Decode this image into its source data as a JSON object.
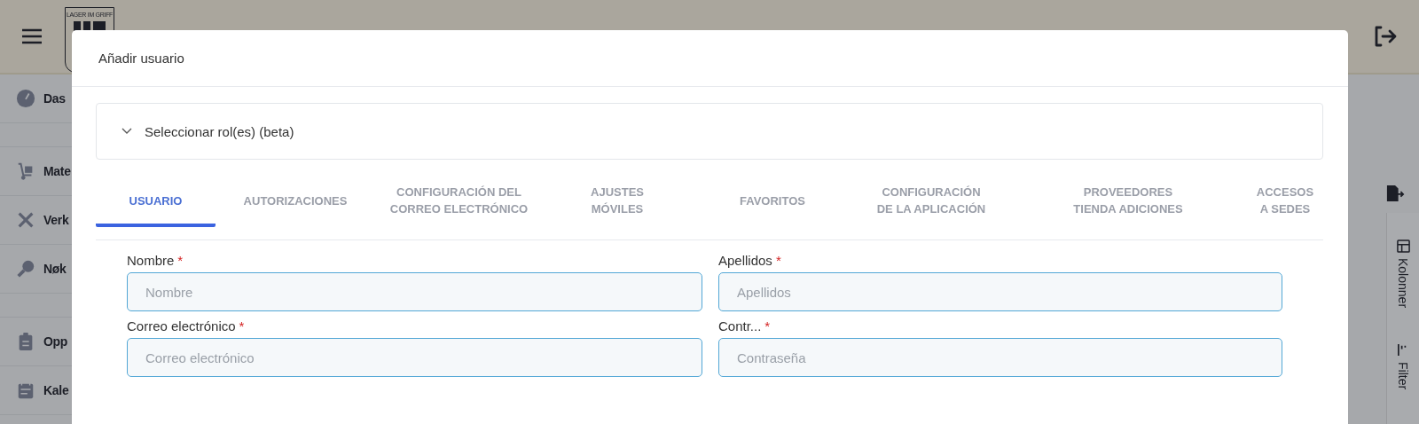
{
  "header": {
    "logo_text": "LAGER IM GRIFF"
  },
  "sidebar": {
    "items": [
      {
        "label": "Das",
        "kind": "gauge"
      },
      {
        "label": "Mate",
        "kind": "cart"
      },
      {
        "label": "Verk",
        "kind": "tools"
      },
      {
        "label": "Nøk",
        "kind": "key"
      },
      {
        "label": "Opp",
        "kind": "clipboard"
      },
      {
        "label": "Kale",
        "kind": "calendar"
      }
    ]
  },
  "side_panel": {
    "tabs": [
      {
        "label": "Kolonner",
        "kind": "columns"
      },
      {
        "label": "Filter",
        "kind": "filter"
      }
    ]
  },
  "dialog": {
    "title": "Añadir usuario",
    "accordion": {
      "label": "Seleccionar rol(es) (beta)",
      "expanded": false
    },
    "tabs": [
      {
        "label": "USUARIO",
        "selected": true
      },
      {
        "label": "AUTORIZACIONES",
        "selected": false
      },
      {
        "label": "CONFIGURACIÓN DEL\nCORREO ELECTRÓNICO",
        "selected": false
      },
      {
        "label": "AJUSTES\nMÓVILES",
        "selected": false
      },
      {
        "label": "FAVORITOS",
        "selected": false
      },
      {
        "label": "CONFIGURACIÓN\nDE LA APLICACIÓN",
        "selected": false
      },
      {
        "label": "PROVEEDORES\nTIENDA ADICIONES",
        "selected": false
      },
      {
        "label": "ACCESOS\nA SEDES",
        "selected": false
      }
    ],
    "fields": [
      {
        "label": "Nombre",
        "required_mark": "*",
        "placeholder": "Nombre"
      },
      {
        "label": "Apellidos",
        "required_mark": "*",
        "placeholder": "Apellidos"
      },
      {
        "label": "Correo electrónico",
        "required_mark": "*",
        "placeholder": "Correo electrónico"
      },
      {
        "label": "Contr...",
        "required_mark": "*",
        "placeholder": "Contraseña"
      }
    ]
  }
}
